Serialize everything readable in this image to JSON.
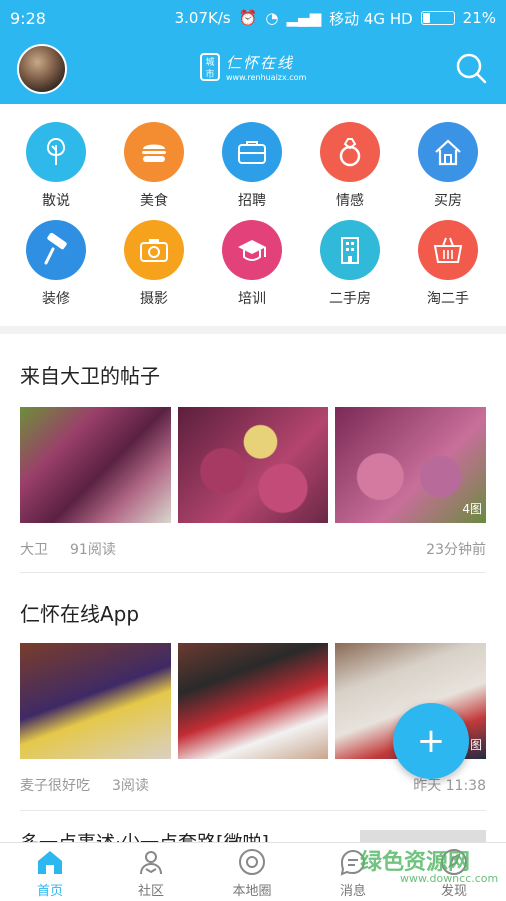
{
  "status": {
    "time": "9:28",
    "speed": "3.07K/s",
    "carrier": "移动 4G HD",
    "battery": "21%"
  },
  "header": {
    "logo_text": "仁怀在线",
    "logo_badge": "城市",
    "logo_url": "www.renhuaizx.com"
  },
  "categories": [
    {
      "label": "散说",
      "color": "#2fb9ea",
      "icon": "tree-icon"
    },
    {
      "label": "美食",
      "color": "#f48c31",
      "icon": "burger-icon"
    },
    {
      "label": "招聘",
      "color": "#2d9ee8",
      "icon": "briefcase-icon"
    },
    {
      "label": "情感",
      "color": "#f25e4d",
      "icon": "ring-icon"
    },
    {
      "label": "买房",
      "color": "#3b93e6",
      "icon": "house-icon"
    },
    {
      "label": "装修",
      "color": "#2f8fe2",
      "icon": "roller-icon"
    },
    {
      "label": "摄影",
      "color": "#f7a21d",
      "icon": "camera-icon"
    },
    {
      "label": "培训",
      "color": "#e2417a",
      "icon": "graduation-cap-icon"
    },
    {
      "label": "二手房",
      "color": "#30b9d8",
      "icon": "building-icon"
    },
    {
      "label": "淘二手",
      "color": "#f25a4c",
      "icon": "basket-icon"
    }
  ],
  "posts": [
    {
      "title": "来自大卫的帖子",
      "author": "大卫",
      "reads": "91阅读",
      "time": "23分钟前",
      "image_count": "4图"
    },
    {
      "title": "仁怀在线App",
      "author": "麦子很好吃",
      "reads": "3阅读",
      "time": "昨天 11:38",
      "image_count": "图"
    }
  ],
  "partial_title": "多一点事述·少一点套路[微啪]",
  "fab_label": "+",
  "tabs": [
    {
      "label": "首页",
      "icon": "home-icon",
      "active": true
    },
    {
      "label": "社区",
      "icon": "community-icon",
      "active": false
    },
    {
      "label": "本地圈",
      "icon": "local-circle-icon",
      "active": false
    },
    {
      "label": "消息",
      "icon": "message-icon",
      "active": false
    },
    {
      "label": "发现",
      "icon": "discover-icon",
      "active": false
    }
  ],
  "watermark": {
    "text": "绿色资源网",
    "url": "www.downcc.com"
  }
}
